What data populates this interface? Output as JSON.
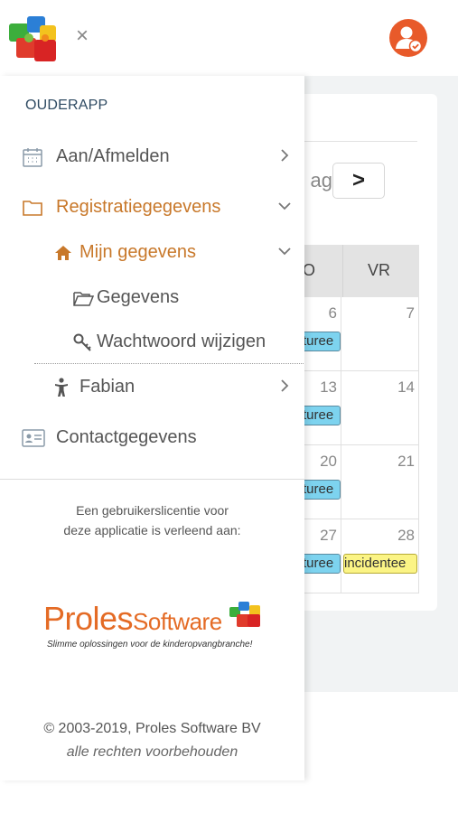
{
  "header": {
    "logo_icon": "puzzle-logo-icon",
    "close_label": "×",
    "avatar_icon": "user-check-icon",
    "avatar_color": "#e85a2a"
  },
  "background": {
    "nav_prev_label": "ag",
    "nav_next_label": ">",
    "calendar": {
      "columns": [
        "O",
        "VR"
      ],
      "rows": [
        {
          "days": [
            "6",
            "7"
          ],
          "events": [
            "turee",
            ""
          ]
        },
        {
          "days": [
            "13",
            "14"
          ],
          "events": [
            "turee",
            ""
          ]
        },
        {
          "days": [
            "20",
            "21"
          ],
          "events": [
            "turee",
            ""
          ]
        },
        {
          "days": [
            "27",
            "28"
          ],
          "events": [
            "turee",
            "incidentee"
          ]
        }
      ],
      "event_colors": {
        "blue": "#7dd3ef",
        "yellow": "#fbf485"
      }
    }
  },
  "drawer": {
    "section_title": "OUDERAPP",
    "items": [
      {
        "label": "Aan/Afmelden",
        "icon": "calendar-icon",
        "chevron": "chevron-right-icon"
      },
      {
        "label": "Registratiegegevens",
        "icon": "folder-icon",
        "chevron": "chevron-down-icon"
      },
      {
        "label": "Mijn gegevens",
        "icon": "home-icon",
        "chevron": "chevron-down-icon"
      },
      {
        "label": "Gegevens",
        "icon": "folder-open-icon"
      },
      {
        "label": "Wachtwoord wijzigen",
        "icon": "key-icon"
      },
      {
        "label": "Fabian",
        "icon": "child-icon",
        "chevron": "chevron-right-icon"
      },
      {
        "label": "Contactgegevens",
        "icon": "id-card-icon"
      }
    ],
    "active_color": "#c8782a",
    "license_line1": "Een gebruikerslicentie voor",
    "license_line2": "deze applicatie is verleend aan:",
    "brand": {
      "name_part1": "Proles",
      "name_part2": "Software",
      "tagline": "Slimme oplossingen voor de kinderopvangbranche!",
      "color": "#e46b25"
    },
    "copyright": "© 2003-2019, Proles Software BV",
    "rights": "alle rechten voorbehouden"
  }
}
